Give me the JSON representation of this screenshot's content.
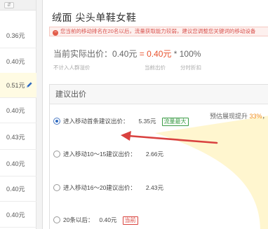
{
  "bid_column": {
    "values": [
      "0.36元",
      "0.40元",
      "0.51元",
      "0.40元",
      "0.43元",
      "0.40元",
      "0.40元",
      "0.40元"
    ]
  },
  "dialog": {
    "title": "绒面 尖头单鞋女鞋",
    "notice": "您当前的移动排名在20名以后，流量获取能力较弱，建议您调整您关键词的移动设备",
    "current": {
      "label": "当前实际出价：",
      "value": "0.40元",
      "eq": " = ",
      "bid": "0.40元",
      "mult": " * 100%"
    },
    "subs": {
      "crowd": "不计入人群溢价",
      "bid": "当前出价",
      "discount": "分时折扣"
    },
    "panel": {
      "title": "建议出价",
      "hint_prefix": "预估展现提升 ",
      "hint_pct": "33%",
      "hint_suffix": "，",
      "options": [
        {
          "label": "进入移动首条建议出价：",
          "price": "5.35元",
          "badge": "流量最大",
          "badge_type": "green",
          "selected": true
        },
        {
          "label": "进入移动10～15建议出价：",
          "price": "2.66元",
          "badge": "",
          "badge_type": "",
          "selected": false
        },
        {
          "label": "进入移动16～20建议出价：",
          "price": "2.43元",
          "badge": "",
          "badge_type": "",
          "selected": false
        },
        {
          "label": "20条以后：",
          "price": "0.40元",
          "badge": "当前",
          "badge_type": "red",
          "selected": false
        }
      ]
    }
  },
  "colors": {
    "accent_red": "#e8522d",
    "radio_blue": "#2f6ac0",
    "badge_green": "#3a9b45",
    "hint_orange": "#f08c17",
    "fan_yellow": "#fff6cf"
  }
}
